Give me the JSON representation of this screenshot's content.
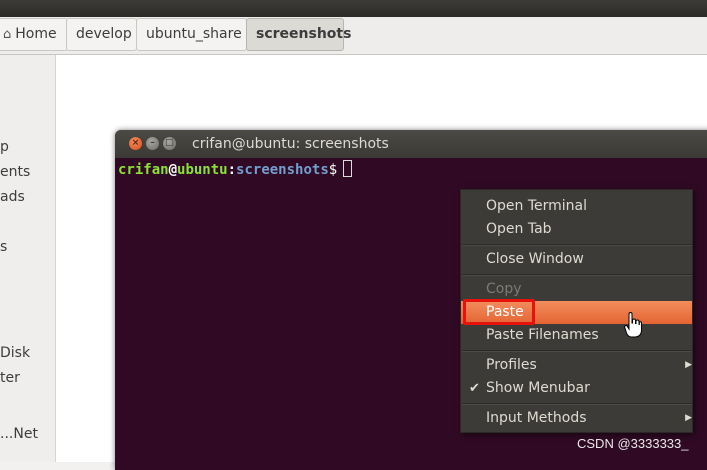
{
  "pathbar": {
    "crumbs": [
      "Home",
      "develop",
      "ubuntu_share",
      "screenshots"
    ]
  },
  "sidebar": {
    "items": [
      "Desktop",
      "Documents",
      "Downloads",
      "Videos",
      "Disk",
      "Computer",
      "Browse Net..."
    ],
    "visible_fragments": [
      "p",
      "ents",
      "ads",
      "s",
      "Disk",
      "ter",
      "Net..."
    ]
  },
  "terminal": {
    "title": "crifan@ubuntu: screenshots",
    "prompt_user": "crifan",
    "prompt_at": "@",
    "prompt_host": "ubuntu",
    "prompt_colon": ":",
    "prompt_path": "screenshots",
    "prompt_dollar": "$"
  },
  "context_menu": {
    "items": [
      {
        "label": "Open Terminal"
      },
      {
        "label": "Open Tab"
      },
      {
        "label": "Close Window"
      },
      {
        "label": "Copy",
        "disabled": true
      },
      {
        "label": "Paste",
        "highlighted": true
      },
      {
        "label": "Paste Filenames"
      },
      {
        "label": "Profiles",
        "submenu": true
      },
      {
        "label": "Show Menubar",
        "checked": true
      },
      {
        "label": "Input Methods",
        "submenu": true
      }
    ]
  },
  "watermark": "CSDN @3333333_",
  "icons": {
    "home": "home-icon",
    "close": "close-icon",
    "minimize": "minimize-icon",
    "maximize": "maximize-icon",
    "submenu": "triangle-right-icon",
    "check": "checkmark-icon",
    "cursor": "hand-pointer-icon"
  },
  "colors": {
    "terminal_bg": "#300a24",
    "menu_bg": "#3c3b37",
    "highlight": "#e96d3e",
    "annotation_box": "#e8120c"
  }
}
